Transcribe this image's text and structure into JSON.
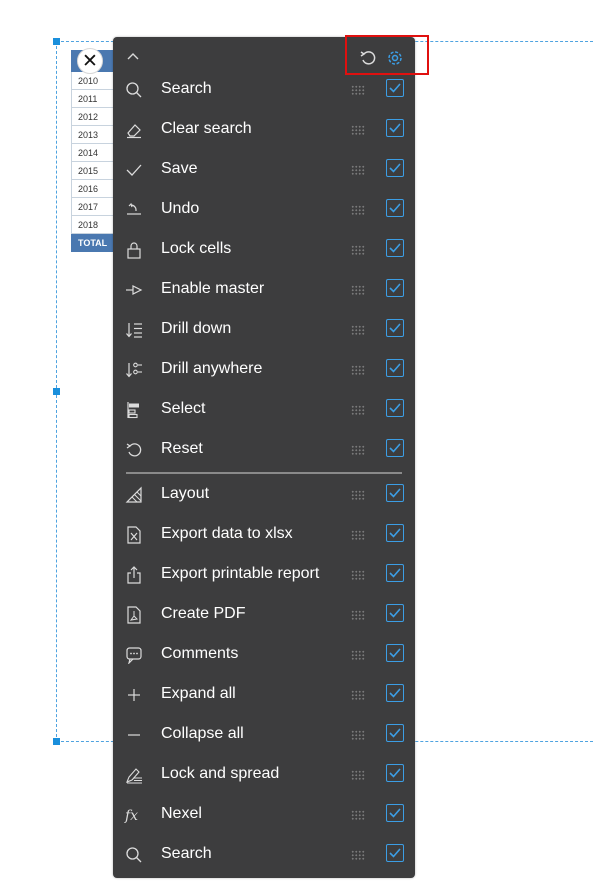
{
  "grid": {
    "years": [
      "2010",
      "2011",
      "2012",
      "2013",
      "2014",
      "2015",
      "2016",
      "2017",
      "2018"
    ],
    "total_label": "TOTAL"
  },
  "toolbar": {
    "close_symbol": "✕"
  },
  "menu": {
    "items": [
      {
        "label": "Search",
        "icon": "search-icon",
        "checked": true
      },
      {
        "label": "Clear search",
        "icon": "eraser-icon",
        "checked": true
      },
      {
        "label": "Save",
        "icon": "checkmark-icon",
        "checked": true
      },
      {
        "label": "Undo",
        "icon": "undo-icon",
        "checked": true
      },
      {
        "label": "Lock cells",
        "icon": "lock-icon",
        "checked": true
      },
      {
        "label": "Enable master",
        "icon": "master-link-icon",
        "checked": true
      },
      {
        "label": "Drill down",
        "icon": "drill-down-icon",
        "checked": true
      },
      {
        "label": "Drill anywhere",
        "icon": "drill-anywhere-icon",
        "checked": true
      },
      {
        "label": "Select",
        "icon": "select-icon",
        "checked": true
      },
      {
        "label": "Reset",
        "icon": "reset-icon",
        "checked": true
      },
      {
        "label": "Layout",
        "icon": "layout-icon",
        "checked": true
      },
      {
        "label": "Export data to xlsx",
        "icon": "xlsx-file-icon",
        "checked": true
      },
      {
        "label": "Export printable report",
        "icon": "export-icon",
        "checked": true
      },
      {
        "label": "Create PDF",
        "icon": "pdf-file-icon",
        "checked": true
      },
      {
        "label": "Comments",
        "icon": "comment-icon",
        "checked": true
      },
      {
        "label": "Expand all",
        "icon": "plus-icon",
        "checked": true
      },
      {
        "label": "Collapse all",
        "icon": "minus-icon",
        "checked": true
      },
      {
        "label": "Lock and spread",
        "icon": "lock-spread-icon",
        "checked": true
      },
      {
        "label": "Nexel",
        "icon": "fx-icon",
        "checked": true
      },
      {
        "label": "Search",
        "icon": "search-icon",
        "checked": true
      }
    ]
  },
  "colors": {
    "panel_bg": "#3d3d3e",
    "accent": "#3c9ee5",
    "highlight": "#e0100f",
    "grid_header": "#4a78b0"
  }
}
